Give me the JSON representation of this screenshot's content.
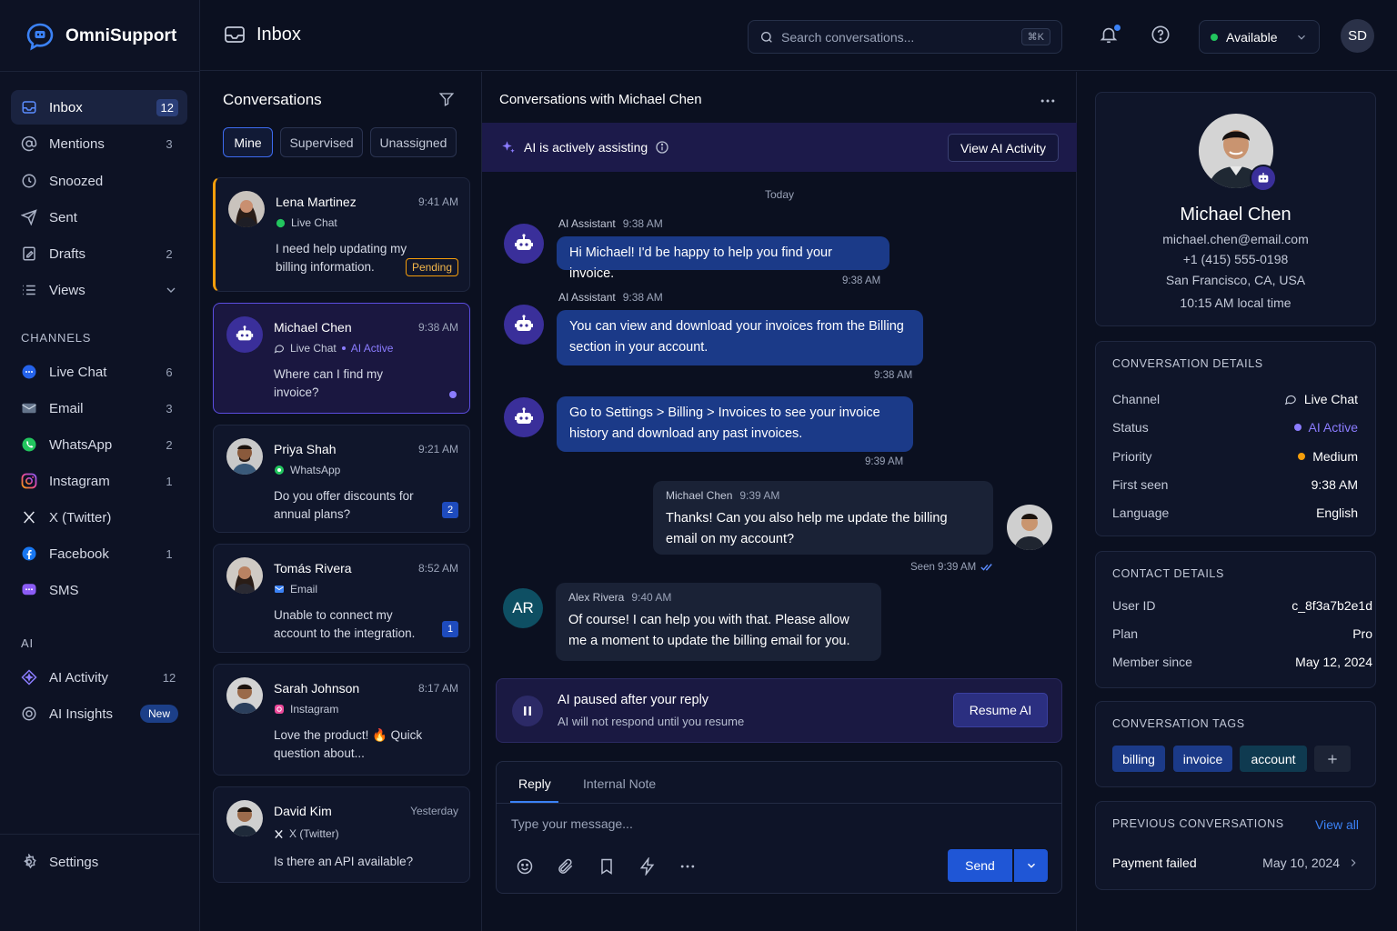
{
  "brand": {
    "name": "OmniSupport"
  },
  "sidebar": {
    "main": [
      {
        "label": "Inbox",
        "count": "12",
        "icon": "inbox-icon"
      },
      {
        "label": "Mentions",
        "count": "3",
        "icon": "at-icon"
      },
      {
        "label": "Snoozed",
        "count": "",
        "icon": "clock-icon"
      },
      {
        "label": "Sent",
        "count": "",
        "icon": "send-icon"
      },
      {
        "label": "Drafts",
        "count": "2",
        "icon": "drafts-icon"
      },
      {
        "label": "Views",
        "count": "",
        "icon": "list-icon"
      }
    ],
    "channels_heading": "CHANNELS",
    "channels": [
      {
        "label": "Live Chat",
        "count": "6",
        "icon": "live-chat-icon"
      },
      {
        "label": "Email",
        "count": "3",
        "icon": "email-icon"
      },
      {
        "label": "WhatsApp",
        "count": "2",
        "icon": "whatsapp-icon"
      },
      {
        "label": "Instagram",
        "count": "1",
        "icon": "instagram-icon"
      },
      {
        "label": "X (Twitter)",
        "count": "",
        "icon": "x-twitter-icon"
      },
      {
        "label": "Facebook",
        "count": "1",
        "icon": "facebook-icon"
      },
      {
        "label": "SMS",
        "count": "",
        "icon": "sms-icon"
      }
    ],
    "ai_heading": "AI",
    "ai": [
      {
        "label": "AI Activity",
        "count": "12",
        "icon": "ai-activity-icon"
      },
      {
        "label": "AI Insights",
        "badge": "New",
        "icon": "ai-insights-icon"
      }
    ],
    "settings_label": "Settings"
  },
  "topbar": {
    "title": "Inbox",
    "search_placeholder": "Search conversations...",
    "search_shortcut": "⌘K",
    "status": "Available",
    "user_initials": "SD"
  },
  "conversations": {
    "title": "Conversations",
    "tabs": [
      "Mine",
      "Supervised",
      "Unassigned"
    ],
    "items": [
      {
        "name": "Lena Martinez",
        "time": "9:41 AM",
        "channel": "Live Chat",
        "preview": "I need help updating my billing information.",
        "tag": "Pending"
      },
      {
        "name": "Michael Chen",
        "time": "9:38 AM",
        "channel": "Live Chat",
        "ai_status": "AI Active",
        "preview": "Where can I find my invoice?"
      },
      {
        "name": "Priya Shah",
        "time": "9:21 AM",
        "channel": "WhatsApp",
        "preview": "Do you offer discounts for annual plans?",
        "unread": "2"
      },
      {
        "name": "Tomás Rivera",
        "time": "8:52 AM",
        "channel": "Email",
        "preview": "Unable to connect my account to the integration.",
        "unread": "1"
      },
      {
        "name": "Sarah Johnson",
        "time": "8:17 AM",
        "channel": "Instagram",
        "preview": "Love the product! 🔥 Quick question about..."
      },
      {
        "name": "David Kim",
        "time": "Yesterday",
        "channel": "X (Twitter)",
        "preview": "Is there an API available?"
      }
    ]
  },
  "chat": {
    "title": "Conversations with Michael Chen",
    "ai_banner": "AI is actively assisting",
    "view_ai_button": "View AI Activity",
    "day_label": "Today",
    "messages": [
      {
        "sender": "AI Assistant",
        "time": "9:38 AM",
        "text": "Hi Michael! I'd be happy to help you find your invoice.",
        "stamp": "9:38 AM"
      },
      {
        "sender": "AI Assistant",
        "time": "9:38 AM",
        "text": "You can view and download your invoices from the Billing section in your account.",
        "stamp": "9:38 AM"
      },
      {
        "text": "Go to Settings > Billing > Invoices to see your invoice history and download any past invoices.",
        "stamp": "9:39 AM"
      },
      {
        "sender": "Michael Chen",
        "time": "9:39 AM",
        "text": "Thanks! Can you also help me update the billing email on my account?",
        "stamp": "Seen 9:39 AM"
      },
      {
        "sender": "Alex Rivera",
        "time": "9:40 AM",
        "initials": "AR",
        "text": "Of course! I can help you with that. Please allow me a moment to update the billing email for you."
      }
    ],
    "paused_title": "AI paused after your reply",
    "paused_sub": "AI will not respond until you resume",
    "resume_button": "Resume AI",
    "composer": {
      "tabs": [
        "Reply",
        "Internal Note"
      ],
      "placeholder": "Type your message...",
      "send": "Send"
    }
  },
  "contact": {
    "name": "Michael Chen",
    "email": "michael.chen@email.com",
    "phone": "+1 (415) 555-0198",
    "location": "San Francisco, CA, USA",
    "local_time": "10:15 AM local time"
  },
  "conversation_details": {
    "heading": "CONVERSATION DETAILS",
    "rows": [
      {
        "key": "Channel",
        "value": "Live Chat"
      },
      {
        "key": "Status",
        "value": "AI Active"
      },
      {
        "key": "Priority",
        "value": "Medium"
      },
      {
        "key": "First seen",
        "value": "9:38 AM"
      },
      {
        "key": "Language",
        "value": "English"
      }
    ]
  },
  "contact_details": {
    "heading": "CONTACT DETAILS",
    "rows": [
      {
        "key": "User ID",
        "value": "c_8f3a7b2e1d"
      },
      {
        "key": "Plan",
        "value": "Pro"
      },
      {
        "key": "Member since",
        "value": "May 12, 2024"
      }
    ]
  },
  "tags": {
    "heading": "CONVERSATION TAGS",
    "items": [
      "billing",
      "invoice",
      "account"
    ]
  },
  "previous": {
    "heading": "PREVIOUS CONVERSATIONS",
    "view_all": "View all",
    "items": [
      {
        "title": "Payment failed",
        "date": "May 10, 2024"
      }
    ]
  },
  "colors": {
    "accent": "#3b82f6",
    "ai_purple": "#8b7cff",
    "pending": "#f59e0b",
    "available": "#22c55e"
  }
}
